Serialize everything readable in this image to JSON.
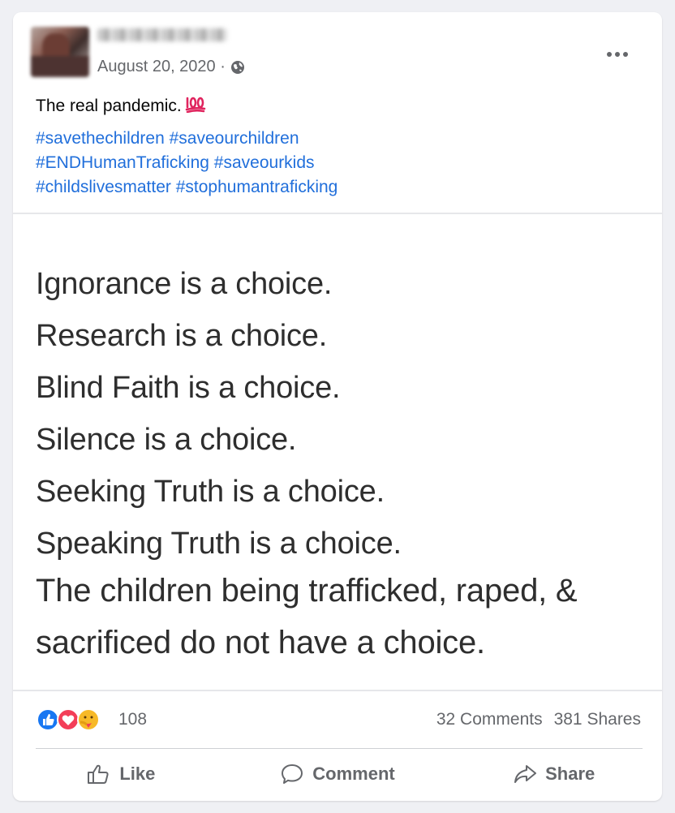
{
  "post": {
    "date": "August 20, 2020 ·",
    "text": "The real pandemic.",
    "emoji_label": "100",
    "hashtags": [
      "#savethechildren #saveourchildren",
      "#ENDHumanTraficking #saveourkids",
      "#childslivesmatter #stophumantraficking"
    ]
  },
  "image": {
    "lines": [
      "Ignorance is a choice.",
      "Research is a choice.",
      "Blind Faith is a choice.",
      "Silence is a choice.",
      "Seeking Truth is a choice.",
      "Speaking Truth is a choice."
    ],
    "final": [
      "The children being trafficked, raped, &",
      "sacrificed do not have a choice."
    ]
  },
  "stats": {
    "reaction_count": "108",
    "comments": "32 Comments",
    "shares": "381 Shares"
  },
  "actions": {
    "like": "Like",
    "comment": "Comment",
    "share": "Share"
  },
  "colors": {
    "hashtag": "#216fdb",
    "secondary_text": "#65676b",
    "like_blue": "#1877f2",
    "love_red": "#f33e58",
    "care_yellow": "#f7b928",
    "emoji_100_red": "#e0245e"
  },
  "icons": [
    "more-icon",
    "globe-icon",
    "like-reaction-icon",
    "love-reaction-icon",
    "care-reaction-icon",
    "like-icon",
    "comment-icon",
    "share-icon",
    "hundred-emoji-icon"
  ]
}
